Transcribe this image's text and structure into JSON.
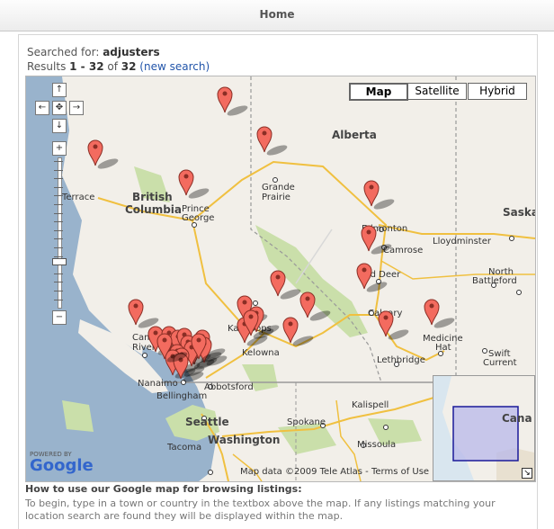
{
  "tabs": {
    "home": "Home"
  },
  "search": {
    "prefix": "Searched for: ",
    "term": "adjusters",
    "results_prefix": "Results ",
    "range": "1 - 32",
    "of": " of ",
    "total": "32",
    "new_search": "(new search)"
  },
  "map": {
    "types": {
      "map": "Map",
      "satellite": "Satellite",
      "hybrid": "Hybrid"
    },
    "attribution": "Map data ©2009 Tele Atlas - Terms of Use",
    "powered_by": "POWERED BY",
    "google": "Google",
    "controls": {
      "up": "↑",
      "left": "←",
      "center": "✥",
      "right": "→",
      "down": "↓",
      "zoom_in": "+",
      "zoom_out": "−"
    },
    "labels": {
      "alberta": "Alberta",
      "bc1": "British",
      "bc2": "Columbia",
      "terrace": "Terrace",
      "grande1": "Grande",
      "grande2": "Prairie",
      "pgeorge1": "Prince",
      "pgeorge2": "George",
      "edmonton": "Edmonton",
      "camrose": "Camrose",
      "lloyd": "Lloydminster",
      "saskatoon": "Saskato",
      "nbattle1": "North",
      "nbattle2": "Battleford",
      "reddeer": "Red Deer",
      "calgary": "Calgary",
      "kamloops": "Kamloops",
      "campbell1": "Campbell",
      "campbell2": "River",
      "nanaimo": "Nanaimo",
      "bellingham": "Bellingham",
      "abbotsford": "Abbotsford",
      "kelowna": "Kelowna",
      "lethbridge": "Lethbridge",
      "medhat1": "Medicine",
      "medhat2": "Hat",
      "swift1": "Swift",
      "swift2": "Current",
      "seattle": "Seattle",
      "tacoma": "Tacoma",
      "washington": "Washington",
      "spokane": "Spokane",
      "kalispell": "Kalispell",
      "missoula": "Missoula",
      "canada": "Cana"
    }
  },
  "help": {
    "title": "How to use our Google map for browsing listings:",
    "text": "To begin, type in a town or country in the textbox above the map. If any listings matching your location search are found they will be displayed within the map."
  },
  "colors": {
    "pin": "#f36b5f",
    "water": "#99b3cc",
    "park": "#cadfaa",
    "link": "#2255aa"
  }
}
